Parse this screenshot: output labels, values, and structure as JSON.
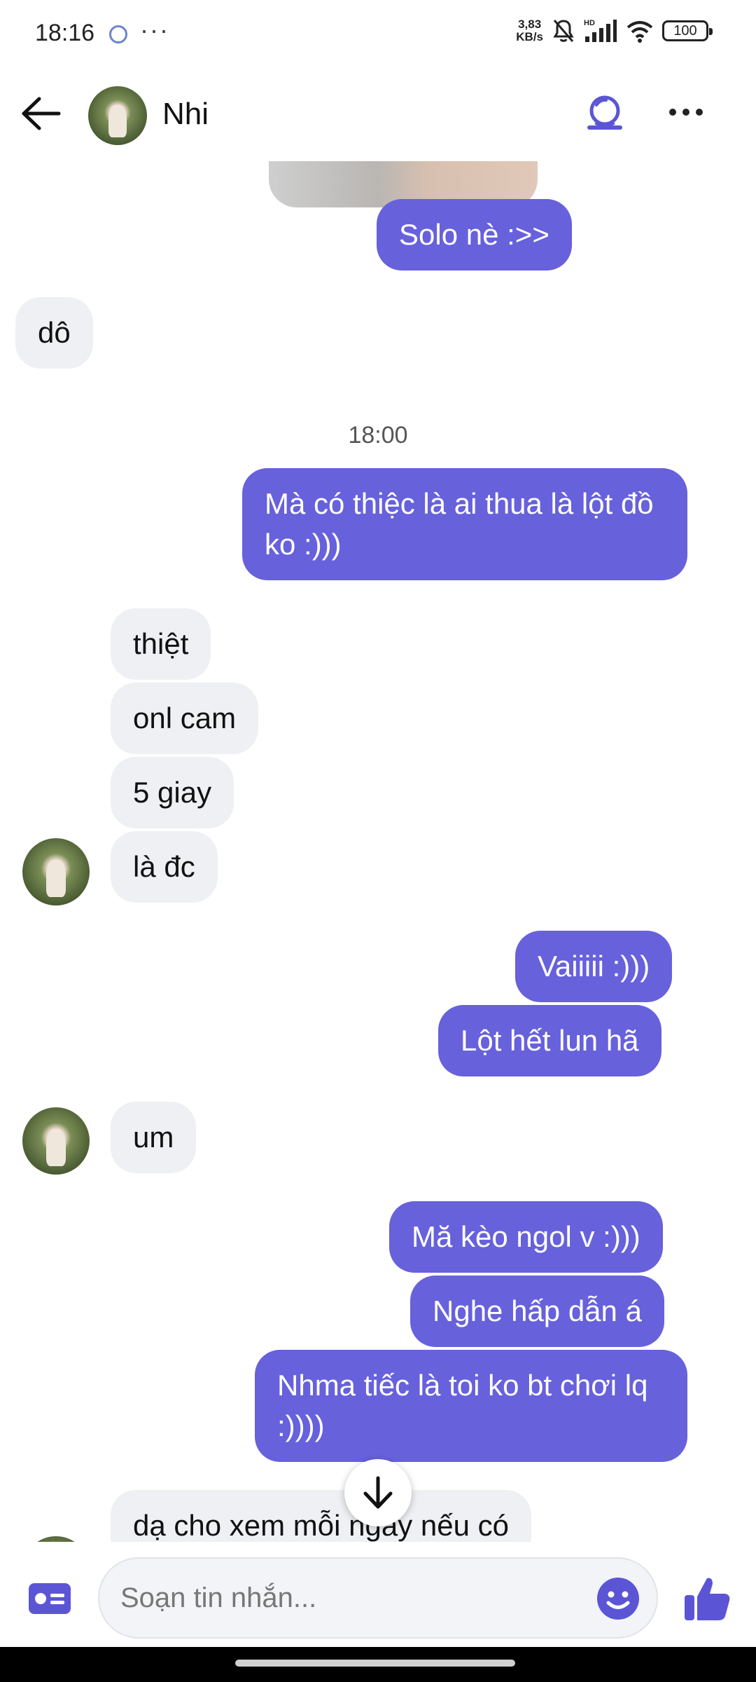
{
  "status_bar": {
    "time": "18:16",
    "more": "···",
    "net_speed_value": "3,83",
    "net_speed_unit": "KB/s",
    "hd_label": "HD",
    "battery": "100"
  },
  "header": {
    "contact_name": "Nhi"
  },
  "chat": {
    "messages": [
      {
        "text": "Solo nè :>>"
      },
      {
        "text": "dô"
      },
      {
        "text": "Mà có thiệc là ai thua là lột đồ ko :)))"
      },
      {
        "text": "thiệt"
      },
      {
        "text": "onl cam"
      },
      {
        "text": "5 giay"
      },
      {
        "text": "là đc"
      },
      {
        "text": "Vaiiiii :)))"
      },
      {
        "text": "Lột hết lun hã"
      },
      {
        "text": "um"
      },
      {
        "text": "Mă kèo ngol v :)))"
      },
      {
        "text": "Nghe hấp dẫn á"
      },
      {
        "text": "Nhma tiếc là toi ko bt chơi lq :))))"
      },
      {
        "text": "dạ cho xem mỗi ngày nếu có"
      }
    ],
    "timestamp": "18:00"
  },
  "composer": {
    "placeholder": "Soạn tin nhắn..."
  },
  "colors": {
    "accent": "#6761dc",
    "incoming_bubble": "#eef0f3",
    "icon_accent": "#5b55d6"
  },
  "icons": {
    "back": "arrow-left-icon",
    "call": "video-call-icon",
    "more": "more-dots-icon",
    "scroll": "arrow-down-icon",
    "card": "contact-card-icon",
    "emoji": "smiley-icon",
    "like": "thumbs-up-icon"
  }
}
